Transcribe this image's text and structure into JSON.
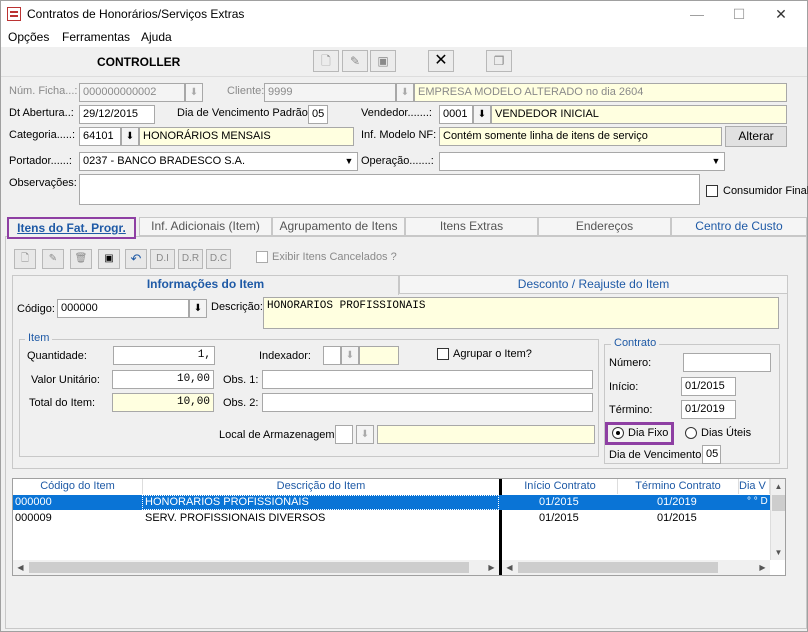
{
  "window": {
    "title": "Contratos de Honorários/Serviços Extras",
    "minimize": "—",
    "maximize": "☐",
    "close": "✕"
  },
  "menu": [
    "Opções",
    "Ferramentas",
    "Ajuda"
  ],
  "toolbar": {
    "title": "CONTROLLER",
    "close_glyph": "✕"
  },
  "form": {
    "num_ficha_label": "Núm. Ficha...:",
    "num_ficha": "000000000002",
    "cliente_label": "Cliente:",
    "cliente_code": "9999",
    "cliente_name": "EMPRESA MODELO ALTERADO no dia 2604",
    "dt_abertura_label": "Dt Abertura..:",
    "dt_abertura": "29/12/2015",
    "dia_venc_label": "Dia de Vencimento Padrão:",
    "dia_venc": "05",
    "vendedor_label": "Vendedor.......:",
    "vendedor_code": "0001",
    "vendedor_name": "VENDEDOR INICIAL",
    "categoria_label": "Categoria.....:",
    "categoria_code": "64101",
    "categoria_name": "HONORÁRIOS MENSAIS",
    "inf_modelo_label": "Inf. Modelo NF:",
    "inf_modelo": "Contém somente linha de itens de serviço",
    "alterar": "Alterar",
    "portador_label": "Portador......:",
    "portador": "0237 - BANCO BRADESCO S.A.",
    "operacao_label": "Operação.......:",
    "operacao": "",
    "observacoes_label": "Observações:",
    "observacoes": "",
    "consumidor_final": "Consumidor Final"
  },
  "tabs": [
    "Itens do Fat. Progr.",
    "Inf. Adicionais (Item)",
    "Agrupamento de Itens",
    "Itens Extras",
    "Endereços",
    "Centro de Custo"
  ],
  "subtoolbar": {
    "di": "D.I",
    "dr": "D.R",
    "dc": "D.C",
    "exibir": "Exibir Itens Cancelados ?"
  },
  "item_tabs": [
    "Informações do Item",
    "Desconto / Reajuste do Item"
  ],
  "item": {
    "codigo_label": "Código:",
    "codigo": "000000",
    "descricao_label": "Descrição:",
    "descricao": "HONORARIOS PROFISSIONAIS",
    "group_title": "Item",
    "quantidade_label": "Quantidade:",
    "quantidade": "1,",
    "indexador_label": "Indexador:",
    "agrupar_label": "Agrupar o Item?",
    "valor_unit_label": "Valor Unitário:",
    "valor_unit": "10,00",
    "obs1_label": "Obs. 1:",
    "total_label": "Total do Item:",
    "total": "10,00",
    "obs2_label": "Obs. 2:",
    "local_label": "Local de Armazenagem:"
  },
  "contrato": {
    "title": "Contrato",
    "numero_label": "Número:",
    "numero": "",
    "inicio_label": "Início:",
    "inicio": "01/2015",
    "termino_label": "Término:",
    "termino": "01/2019",
    "dia_fixo": "Dia Fixo",
    "dias_uteis": "Dias Úteis",
    "dia_venc_label": "Dia de Vencimento:",
    "dia_venc": "05"
  },
  "grid": {
    "headers": [
      "Código do Item",
      "Descrição do Item",
      "Início Contrato",
      "Término Contrato",
      "Dia V"
    ],
    "rows": [
      {
        "codigo": "000000",
        "descricao": "HONORARIOS PROFISSIONAIS",
        "inicio": "01/2015",
        "termino": "01/2019",
        "dia": "° ° D"
      },
      {
        "codigo": "000009",
        "descricao": "SERV. PROFISSIONAIS DIVERSOS",
        "inicio": "01/2015",
        "termino": "01/2015",
        "dia": ""
      }
    ]
  },
  "colors": {
    "accent": "#1f5aa6",
    "highlight_border": "#8e3fa3",
    "selected_row": "#0a74d6",
    "yellow_field": "#ffffe0"
  }
}
